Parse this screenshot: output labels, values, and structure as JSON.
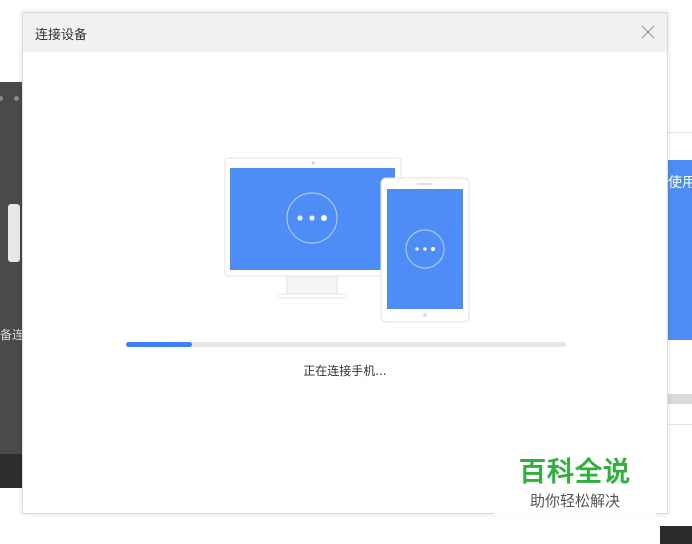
{
  "dialog": {
    "title": "连接设备",
    "status_text": "正在连接手机...",
    "progress": 0.15
  },
  "background": {
    "left_text": "备连",
    "right_text": "使用"
  },
  "watermark": {
    "main": "百科全说",
    "sub": "助你轻松解决"
  },
  "colors": {
    "accent": "#3d82f4",
    "screen_blue": "#4d8df5",
    "watermark_green": "#2db13b"
  },
  "icons": [
    "close-icon",
    "monitor-icon",
    "tablet-icon",
    "loading-dots-icon"
  ]
}
